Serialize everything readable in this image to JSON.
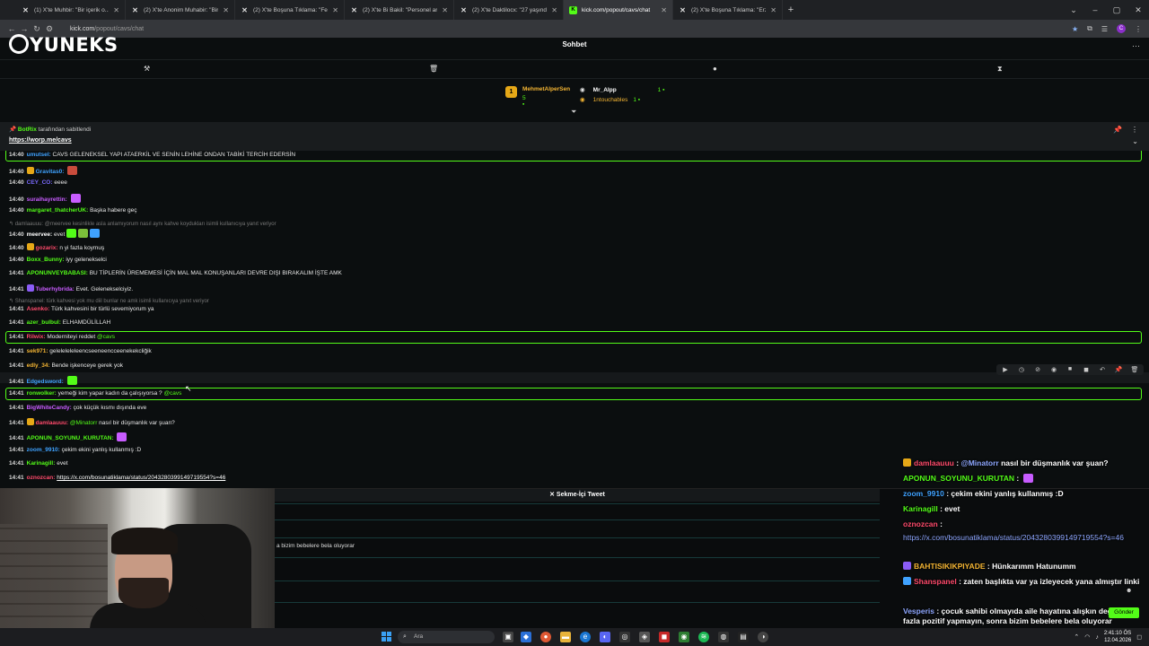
{
  "browser": {
    "tabs": [
      {
        "label": "(1) X'te Muhbir: \"Bir içerik o...",
        "icon": "x-logo-icon"
      },
      {
        "label": "(2) X'te Anonim Muhabir: \"Bir g...",
        "icon": "x-logo-icon"
      },
      {
        "label": "(2) X'te Boşuna Tıklama: \"Fenom...",
        "icon": "x-logo-icon"
      },
      {
        "label": "(2) X'te Bi Bakil: \"Personel arasın...",
        "icon": "x-logo-icon"
      },
      {
        "label": "(2) X'te Daktilocx: \"27 yaşındayı...",
        "icon": "x-logo-icon"
      },
      {
        "label": "kick.com/popout/cavs/chat",
        "icon": "kick-icon",
        "active": true
      },
      {
        "label": "(2) X'te Boşuna Tıklama: \"Erzurum...",
        "icon": "x-logo-icon"
      }
    ],
    "url_host": "kick.com",
    "url_path": "/popout/cavs/chat"
  },
  "chat": {
    "logo_text": "YUNEKS",
    "title": "Sohbet",
    "leaderboard": {
      "first": {
        "rank": "1",
        "name": "MehmetAlperSen",
        "count": "5"
      },
      "second": {
        "name": "Mr_Alpp",
        "count": "1"
      },
      "third": {
        "name": "1ntouchables",
        "count": "1"
      }
    },
    "pinned": {
      "pinned_by_user": "BotRix",
      "pinned_by_suffix": "tarafından sabitlendi",
      "link": "https://worp.me/cavs"
    },
    "messages": [
      {
        "time": "14:40",
        "user": "umutsel:",
        "color": "#3fa2ff",
        "text": "CAVS GELENEKSEL YAPI ATAERKİL VE SENİN LEHİNE ONDAN TABİKİ TERCİH EDERSİN"
      },
      {
        "time": "14:40",
        "user": "Gravitas0:",
        "color": "#3fa2ff",
        "text": ""
      },
      {
        "time": "14:40",
        "user": "CEY_CO:",
        "color": "#7b6bff",
        "text": "eeee"
      },
      {
        "time": "14:40",
        "user": "suraihayrettin:",
        "color": "#c85cff",
        "text": ""
      },
      {
        "time": "14:40",
        "user": "margaret_thatcherUK:",
        "color": "#53fc18",
        "text": "Başka habere geç"
      },
      {
        "time": "",
        "user": "",
        "color": "#777777",
        "text": "damlaauuu: @meervee kesinlikle asla anlamıyorum nasıl aynı kahve koydukları isimli kullanıcıya yanıt veriyor"
      },
      {
        "time": "14:40",
        "user": "meervee:",
        "color": "#ffffff",
        "text": "evet"
      },
      {
        "time": "14:40",
        "user": "gozarix:",
        "color": "#ff4a6b",
        "text": "n yi fazla koymuş"
      },
      {
        "time": "14:40",
        "user": "Boxx_Bunny:",
        "color": "#53fc18",
        "text": "iyy gelenekselci"
      },
      {
        "time": "14:41",
        "user": "APONUNVEYBABASI:",
        "color": "#53fc18",
        "text": "BU TİPLERİN ÜREMEMESİ İÇİN MAL MAL KONUŞANLARI DEVRE DIŞI BIRAKALIM İŞTE AMK"
      },
      {
        "time": "14:41",
        "user": "Tuberhybrida:",
        "color": "#c85cff",
        "text": "Evet. Gelenekselciyiz."
      },
      {
        "time": "",
        "user": "",
        "color": "#777777",
        "text": "Shanspanel: türk kahvesi yok mu diil bunlar ne amk isimli kullanıcıya yanıt veriyor"
      },
      {
        "time": "14:41",
        "user": "Asenko:",
        "color": "#ff4a6b",
        "text": "Türk kahvesini bir türlü sevemiyorum ya"
      },
      {
        "time": "14:41",
        "user": "azer_bulbul:",
        "color": "#53fc18",
        "text": "ELHAMDÜLİLLAH"
      },
      {
        "time": "14:41",
        "user": "Rilwix:",
        "color": "#ff4a6b",
        "text": "Moderniteyi reddet",
        "mention": "@cavs"
      },
      {
        "time": "14:41",
        "user": "sek971:",
        "color": "#f4b533",
        "text": "geleleleleleencseeneencceenekekcliğik"
      },
      {
        "time": "14:41",
        "user": "edly_34:",
        "color": "#f4b533",
        "text": "Bende işkenceye gerek yok"
      },
      {
        "time": "14:41",
        "user": "Edgedsword:",
        "color": "#3fa2ff",
        "text": ""
      },
      {
        "time": "14:41",
        "user": "ronwolker:",
        "color": "#53fc18",
        "text": "yemeği kim yapar kadın da çalışıyorsa ?",
        "mention": "@cavs"
      },
      {
        "time": "14:41",
        "user": "BigWhiteCandy:",
        "color": "#c85cff",
        "text": "çok küçük kısmı dışında eve"
      },
      {
        "time": "14:41",
        "user": "damlaauuu:",
        "color": "#ff4a6b",
        "text": "nasıl bir düşmanlık var şuan?",
        "mention": "@Minatorr"
      },
      {
        "time": "14:41",
        "user": "APONUN_SOYUNU_KURUTAN:",
        "color": "#53fc18",
        "text": ""
      },
      {
        "time": "14:41",
        "user": "zoom_9910:",
        "color": "#3fa2ff",
        "text": "çekim ekini yanlış kullanmış :D"
      },
      {
        "time": "14:41",
        "user": "Karinagill:",
        "color": "#53fc18",
        "text": "evet"
      },
      {
        "time": "14:41",
        "user": "oznozcan:",
        "color": "#ff4a6b",
        "text": "",
        "link": "https://x.com/bosunatiklama/status/2043280399149719554?s=46"
      }
    ],
    "message_actions": [
      "play-icon",
      "clock-icon",
      "slash-icon",
      "circle-icon",
      "square-icon",
      "stop-icon",
      "undo-icon",
      "pin-icon",
      "trash-icon"
    ]
  },
  "tweet_panel": {
    "title": "Sekme-İçi Tweet",
    "partial_text": "a bizim bebelere bela oluyorar"
  },
  "overlay_chat": [
    {
      "user": "damlaauuu",
      "color": "#ff4a6b",
      "mention": "@Minatorr",
      "text": "nasıl bir düşmanlık var şuan?"
    },
    {
      "user": "APONUN_SOYUNU_KURUTAN",
      "color": "#53fc18",
      "text": ""
    },
    {
      "user": "zoom_9910",
      "color": "#3fa2ff",
      "text": "çekim ekini yanlış kullanmış :D"
    },
    {
      "user": "Karinagill",
      "color": "#53fc18",
      "text": "evet"
    },
    {
      "user": "oznozcan",
      "color": "#ff4a6b",
      "text": ""
    },
    {
      "link": "https://x.com/bosunatiklama/status/2043280399149719554?s=46"
    },
    {
      "user": "BAHTISIKIKPIYADE",
      "color": "#f4b533",
      "text": "Hünkarımm Hatunumm"
    },
    {
      "user": "Shanspanel",
      "color": "#ff4a6b",
      "text": "zaten başlıkta var ya izleyecek yana almıştır linki"
    },
    {
      "user": "Vesperis",
      "color": "#8ea7ff",
      "text": "çocuk sahibi olmayıda aile hayatına alışkın değilseniz fazla pozitif yapmayın, sonra bizim bebelere bela oluyorar"
    }
  ],
  "send_label": "Gönder",
  "taskbar": {
    "search_placeholder": "Ara",
    "time": "2:41:10 ÖS",
    "date": "12.04.2026"
  }
}
